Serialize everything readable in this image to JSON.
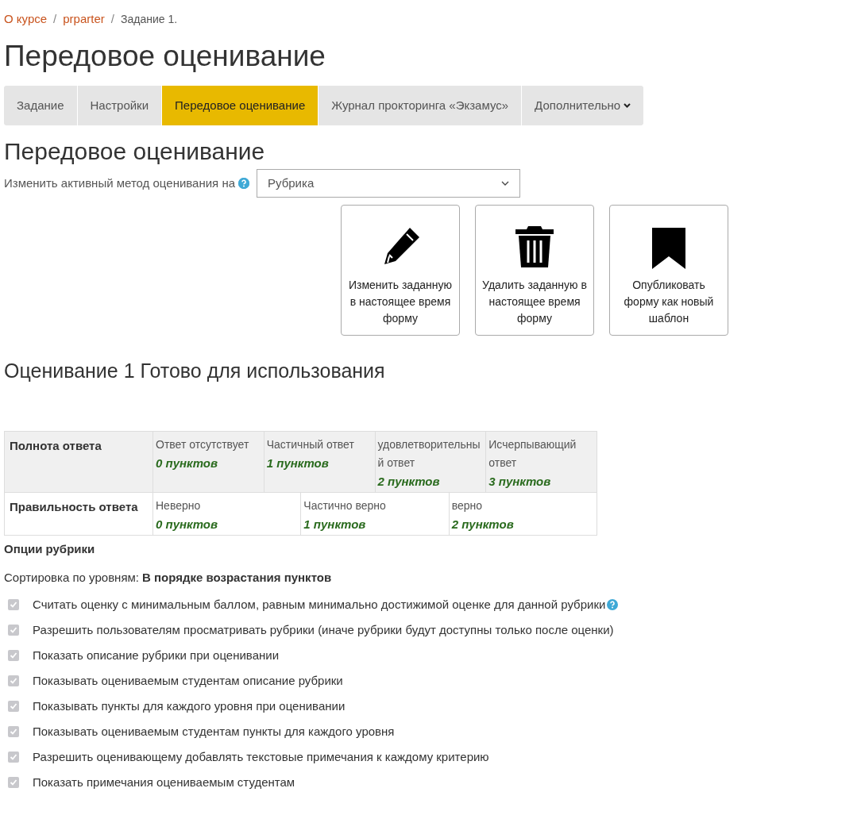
{
  "breadcrumbs": [
    {
      "kind": "link",
      "label": "О курсе"
    },
    {
      "kind": "separator",
      "label": "/"
    },
    {
      "kind": "link",
      "label": "prparter"
    },
    {
      "kind": "separator",
      "label": "/"
    },
    {
      "kind": "current",
      "label": "Задание 1."
    }
  ],
  "page_title": "Передовое оценивание",
  "tabs": [
    {
      "label": "Задание",
      "selected": false,
      "dropdown": false
    },
    {
      "label": "Настройки",
      "selected": false,
      "dropdown": false
    },
    {
      "label": "Передовое оценивание",
      "selected": true,
      "dropdown": false
    },
    {
      "label": "Журнал прокторинга «Экзамус»",
      "selected": false,
      "dropdown": false
    },
    {
      "label": "Дополнительно",
      "selected": false,
      "dropdown": true
    }
  ],
  "section_title": "Передовое оценивание",
  "method": {
    "label": "Изменить активный метод оценивания на",
    "value": "Рубрика"
  },
  "actions": [
    {
      "kind": "pencil",
      "label": "Изменить заданную в настоящее время форму"
    },
    {
      "kind": "trash",
      "label": "Удалить заданную в настоящее время форму"
    },
    {
      "kind": "bookmark",
      "label": "Опубликовать форму как новый шаблон"
    }
  ],
  "status_title": "Оценивание 1 Готово для использования",
  "rubric": [
    {
      "criterion": "Полнота ответа",
      "levels": [
        {
          "definition": "Ответ отсутствует",
          "score": "0 пунктов"
        },
        {
          "definition": "Частичный ответ",
          "score": "1 пунктов"
        },
        {
          "definition": "удовлетворительный ответ",
          "score": "2 пунктов"
        },
        {
          "definition": "Исчерпывающий ответ",
          "score": "3 пунктов"
        }
      ]
    },
    {
      "criterion": "Правильность ответа",
      "levels": [
        {
          "definition": "Неверно",
          "score": "0 пунктов"
        },
        {
          "definition": "Частично верно",
          "score": "1 пунктов"
        },
        {
          "definition": "верно",
          "score": "2 пунктов"
        }
      ]
    }
  ],
  "options_title": "Опции рубрики",
  "sort": {
    "label": "Сортировка по уровням:",
    "value": "В порядке возрастания пунктов"
  },
  "options": [
    {
      "label": "Считать оценку с минимальным баллом, равным минимально достижимой оценке для данной рубрики",
      "checked": true,
      "help": true
    },
    {
      "label": "Разрешить пользователям просматривать рубрики (иначе рубрики будут доступны только после оценки)",
      "checked": true,
      "help": false
    },
    {
      "label": "Показать описание рубрики при оценивании",
      "checked": true,
      "help": false
    },
    {
      "label": "Показывать оцениваемым студентам описание рубрики",
      "checked": true,
      "help": false
    },
    {
      "label": "Показывать пункты для каждого уровня при оценивании",
      "checked": true,
      "help": false
    },
    {
      "label": "Показывать оцениваемым студентам пункты для каждого уровня",
      "checked": true,
      "help": false
    },
    {
      "label": "Разрешить оценивающему добавлять текстовые примечания к каждому критерию",
      "checked": true,
      "help": false
    },
    {
      "label": "Показать примечания оцениваемым студентам",
      "checked": true,
      "help": false
    }
  ]
}
